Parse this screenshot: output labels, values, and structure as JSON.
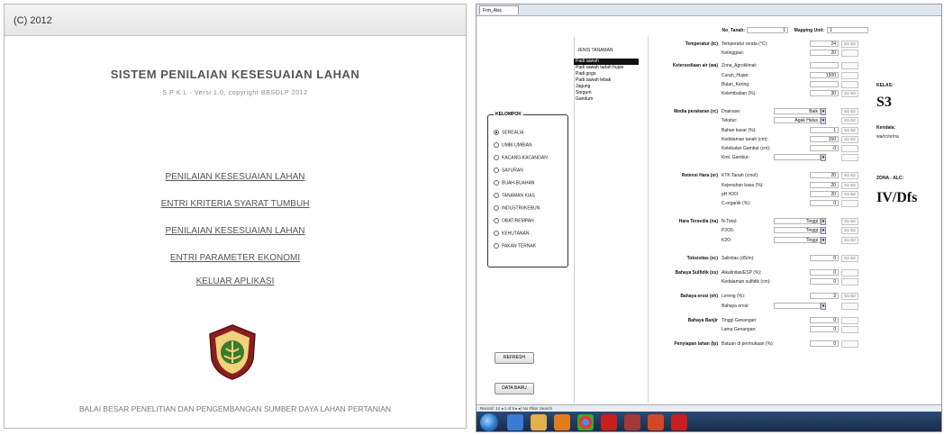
{
  "left": {
    "window_title": "(C) 2012",
    "app_title": "SISTEM PENILAIAN KESESUAIAN LAHAN",
    "version_line": "S P K L  -  Versi 1.0, copyright BBSDLP 2012",
    "menu": [
      "PENILAIAN KESESUAIAN LAHAN",
      "ENTRI KRITERIA SYARAT TUMBUH",
      "PENILAIAN KESESUAIAN LAHAN",
      "ENTRI PARAMETER EKONOMI",
      "KELUAR APLIKASI"
    ],
    "footer": "BALAI BESAR PENELITIAN DAN PENGEMBANGAN SUMBER DAYA LAHAN PERTANIAN",
    "logo_icon": "institution-emblem-icon"
  },
  "right": {
    "tab_label": "Frm_Alsc",
    "header": {
      "no_tanah_label": "No_Tanah:",
      "no_tanah_value": "1",
      "mapping_unit_label": "Mapping Unit:",
      "mapping_unit_value": "1"
    },
    "crops_title": "JENIS TANAMAN",
    "crops": [
      "Padi sawah",
      "Padi sawah tadah hujan",
      "Padi gogo",
      "Padi sawah lebak",
      "Jagung",
      "Sorgum",
      "Gandum"
    ],
    "group_title": "KELOMPOK",
    "groups": [
      "SEREALIA",
      "UMBI-UMBIAN",
      "KACANG-KACANGAN",
      "SAYURAN",
      "BUAH-BUAHAN",
      "TANAMAN KIAS",
      "INDUSTRI/KEBUN",
      "OBAT/REMPAH",
      "KEHUTANAN",
      "PAKAN TERNAK"
    ],
    "buttons": {
      "refresh": "REFRESH",
      "data_baru": "DATA BARU"
    },
    "sections": [
      {
        "title": "Temperatur (tc)",
        "rows": [
          {
            "label": "Temperatur rerata (°C):",
            "value": "24",
            "cls": "S1-S2"
          },
          {
            "label": "Ketinggian:",
            "value": "20",
            "cls": ""
          }
        ]
      },
      {
        "title": "Ketersediaan air (wa)",
        "rows": [
          {
            "label": "Zona_Agroklimat:",
            "value": "",
            "cls": ""
          },
          {
            "label": "Curah_Hujan:",
            "value": "1500",
            "cls": ""
          },
          {
            "label": "Bulan_Kering:",
            "value": "",
            "cls": ""
          },
          {
            "label": "Kelembaban (%):",
            "value": "30",
            "cls": "S1-S3"
          }
        ]
      },
      {
        "title": "Media perakaran (rc)",
        "rows": [
          {
            "label": "Drainase:",
            "value": "Baik",
            "cls": "S1-S2",
            "dropdown": true
          },
          {
            "label": "Tekstur:",
            "value": "Agak Halus",
            "cls": "S1-S2",
            "dropdown": true
          },
          {
            "label": "Bahan kasar (%):",
            "value": "1",
            "cls": "S1-S2"
          },
          {
            "label": "Kedalaman tanah (cm):",
            "value": "150",
            "cls": "S1-S2"
          },
          {
            "label": "Ketebalan Gambut (cm):",
            "value": "0",
            "cls": ""
          },
          {
            "label": "Kmt. Gambut:",
            "value": "",
            "cls": "",
            "dropdown": true
          }
        ]
      },
      {
        "title": "Retensi Hara (nr)",
        "rows": [
          {
            "label": "KTK Tanah (cmol):",
            "value": "20",
            "cls": "S1-S2"
          },
          {
            "label": "Kejenuhan basa (%):",
            "value": "20",
            "cls": "S1-S2"
          },
          {
            "label": "pH H2O:",
            "value": "20",
            "cls": "S1-S2"
          },
          {
            "label": "C-organik (%):",
            "value": "0",
            "cls": ""
          }
        ]
      },
      {
        "title": "Hara Tersedia (na)",
        "rows": [
          {
            "label": "N-Total:",
            "value": "Tinggi",
            "cls": "S1-S2",
            "dropdown": true
          },
          {
            "label": "P2O5:",
            "value": "Tinggi",
            "cls": "S1-S2",
            "dropdown": true
          },
          {
            "label": "K2O:",
            "value": "Tinggi",
            "cls": "S1-S2",
            "dropdown": true
          }
        ]
      },
      {
        "title": "Toksisitas (xc)",
        "rows": [
          {
            "label": "Salinitas (dS/m):",
            "value": "0",
            "cls": "S1-S2"
          }
        ]
      },
      {
        "title": "Bahaya Sulfidik (xs)",
        "rows": [
          {
            "label": "Alkalinitas/ESP (%):",
            "value": "0",
            "cls": ""
          },
          {
            "label": "Kedalaman sulfidik (cm):",
            "value": "0",
            "cls": ""
          }
        ]
      },
      {
        "title": "Bahaya erosi (eh)",
        "rows": [
          {
            "label": "Lereng (%):",
            "value": "3",
            "cls": "S1-S2"
          },
          {
            "label": "Bahaya erosi:",
            "value": "",
            "cls": "",
            "dropdown": true
          }
        ]
      },
      {
        "title": "Bahaya Banjir",
        "rows": [
          {
            "label": "Tinggi Genangan:",
            "value": "0",
            "cls": ""
          },
          {
            "label": "Lama Genangan:",
            "value": "0",
            "cls": ""
          }
        ]
      },
      {
        "title": "Penyiapan lahan (lp)",
        "rows": [
          {
            "label": "Batuan di permukaan (%):",
            "value": "0",
            "cls": ""
          }
        ]
      }
    ],
    "result": {
      "kelas_label": "KELAS:",
      "kelas_value": "S3",
      "kendala_label": "Kendala:",
      "kendala_value": "wa/rc/nr/na",
      "zona_label": "ZONA - ALC:",
      "zona_value": "IV/Dfs"
    },
    "status_text": "Record: 14  ◂ 1 of 5  ▸ ▸|  No Filter  Search",
    "taskbar_icons": [
      "start-orb",
      "ie-icon",
      "folder-icon",
      "media-icon",
      "chrome-icon",
      "acrobat-icon",
      "access-icon",
      "powerpoint-icon",
      "acrobat2-icon"
    ]
  }
}
